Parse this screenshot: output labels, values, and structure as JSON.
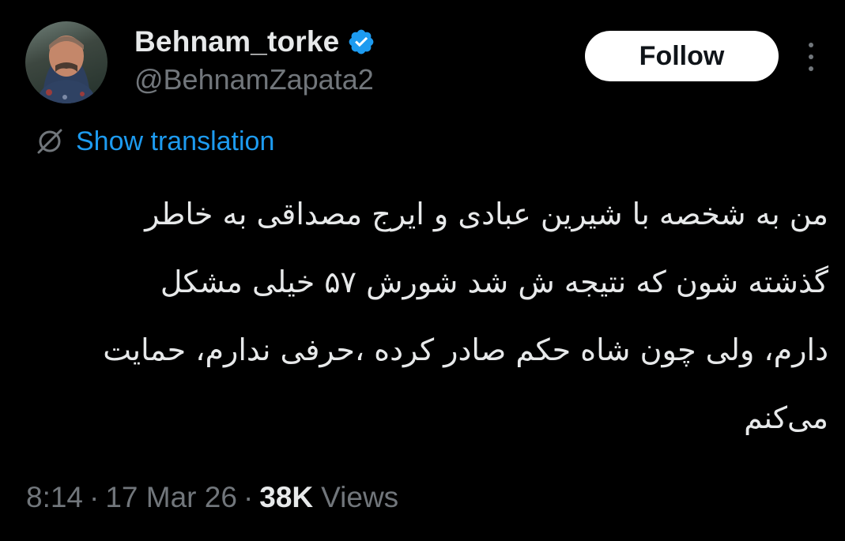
{
  "author": {
    "display_name": "Behnam_torke",
    "handle": "@BehnamZapata2",
    "verified": true,
    "verified_color": "#1d9bf0"
  },
  "actions": {
    "follow_label": "Follow",
    "more_icon": "more-vertical-icon"
  },
  "translation": {
    "label": "Show translation",
    "icon": "translate-icon",
    "color": "#1d9bf0"
  },
  "tweet": {
    "lines": [
      "من به شخصه با شیرین عبادی و ایرج مصداقی به خاطر",
      "گذشته شون که نتیجه ش شد شورش ۵۷ خیلی مشکل",
      "دارم، ولی چون شاه حکم صادر کرده ،حرفی ندارم، حمایت",
      "می‌کنم"
    ]
  },
  "meta": {
    "time": "8:14",
    "date": "17 Mar 26",
    "separator": "·",
    "views_count": "38K",
    "views_label": "Views"
  },
  "colors": {
    "background": "#000000",
    "text_primary": "#e7e9ea",
    "text_secondary": "#71767b",
    "accent": "#1d9bf0"
  }
}
